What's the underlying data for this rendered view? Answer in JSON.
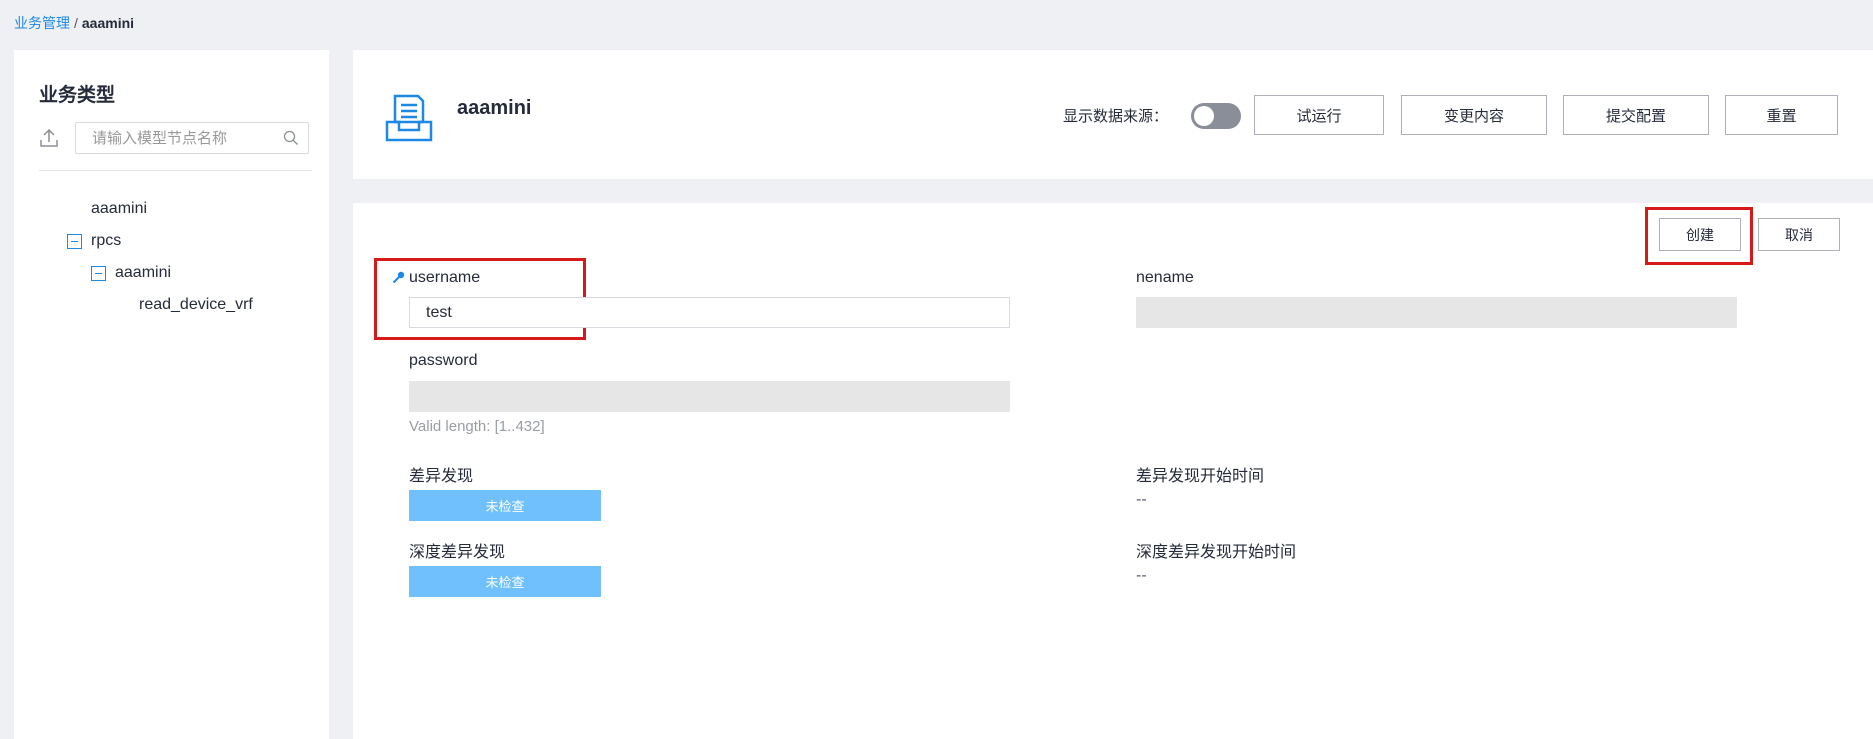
{
  "breadcrumb": {
    "parent": "业务管理",
    "separator": "/",
    "current": "aaamini"
  },
  "sidebar": {
    "title": "业务类型",
    "search_placeholder": "请输入模型节点名称",
    "tree": [
      {
        "label": "aaamini",
        "level": 0,
        "expandable": false
      },
      {
        "label": "rpcs",
        "level": 0,
        "expandable": true,
        "expanded": true
      },
      {
        "label": "aaamini",
        "level": 1,
        "expandable": true,
        "expanded": true
      },
      {
        "label": "read_device_vrf",
        "level": 2,
        "expandable": false
      }
    ]
  },
  "header": {
    "title": "aaamini",
    "show_source_label": "显示数据来源：",
    "show_source_enabled": false,
    "buttons": {
      "trial_run": "试运行",
      "change_content": "变更内容",
      "submit_config": "提交配置",
      "reset": "重置"
    }
  },
  "form": {
    "create_label": "创建",
    "cancel_label": "取消",
    "username": {
      "label": "username",
      "value": "test"
    },
    "nename": {
      "label": "nename"
    },
    "password": {
      "label": "password",
      "hint": "Valid length: [1..432]"
    },
    "diff_discovery": {
      "label": "差异发现",
      "status": "未检查"
    },
    "diff_discovery_start": {
      "label": "差异发现开始时间",
      "value": "--"
    },
    "deep_diff_discovery": {
      "label": "深度差异发现",
      "status": "未检查"
    },
    "deep_diff_discovery_start": {
      "label": "深度差异发现开始时间",
      "value": "--"
    }
  },
  "colors": {
    "accent": "#1e88e5",
    "highlight": "#d61a1a",
    "status_button": "#6fc0fc"
  }
}
